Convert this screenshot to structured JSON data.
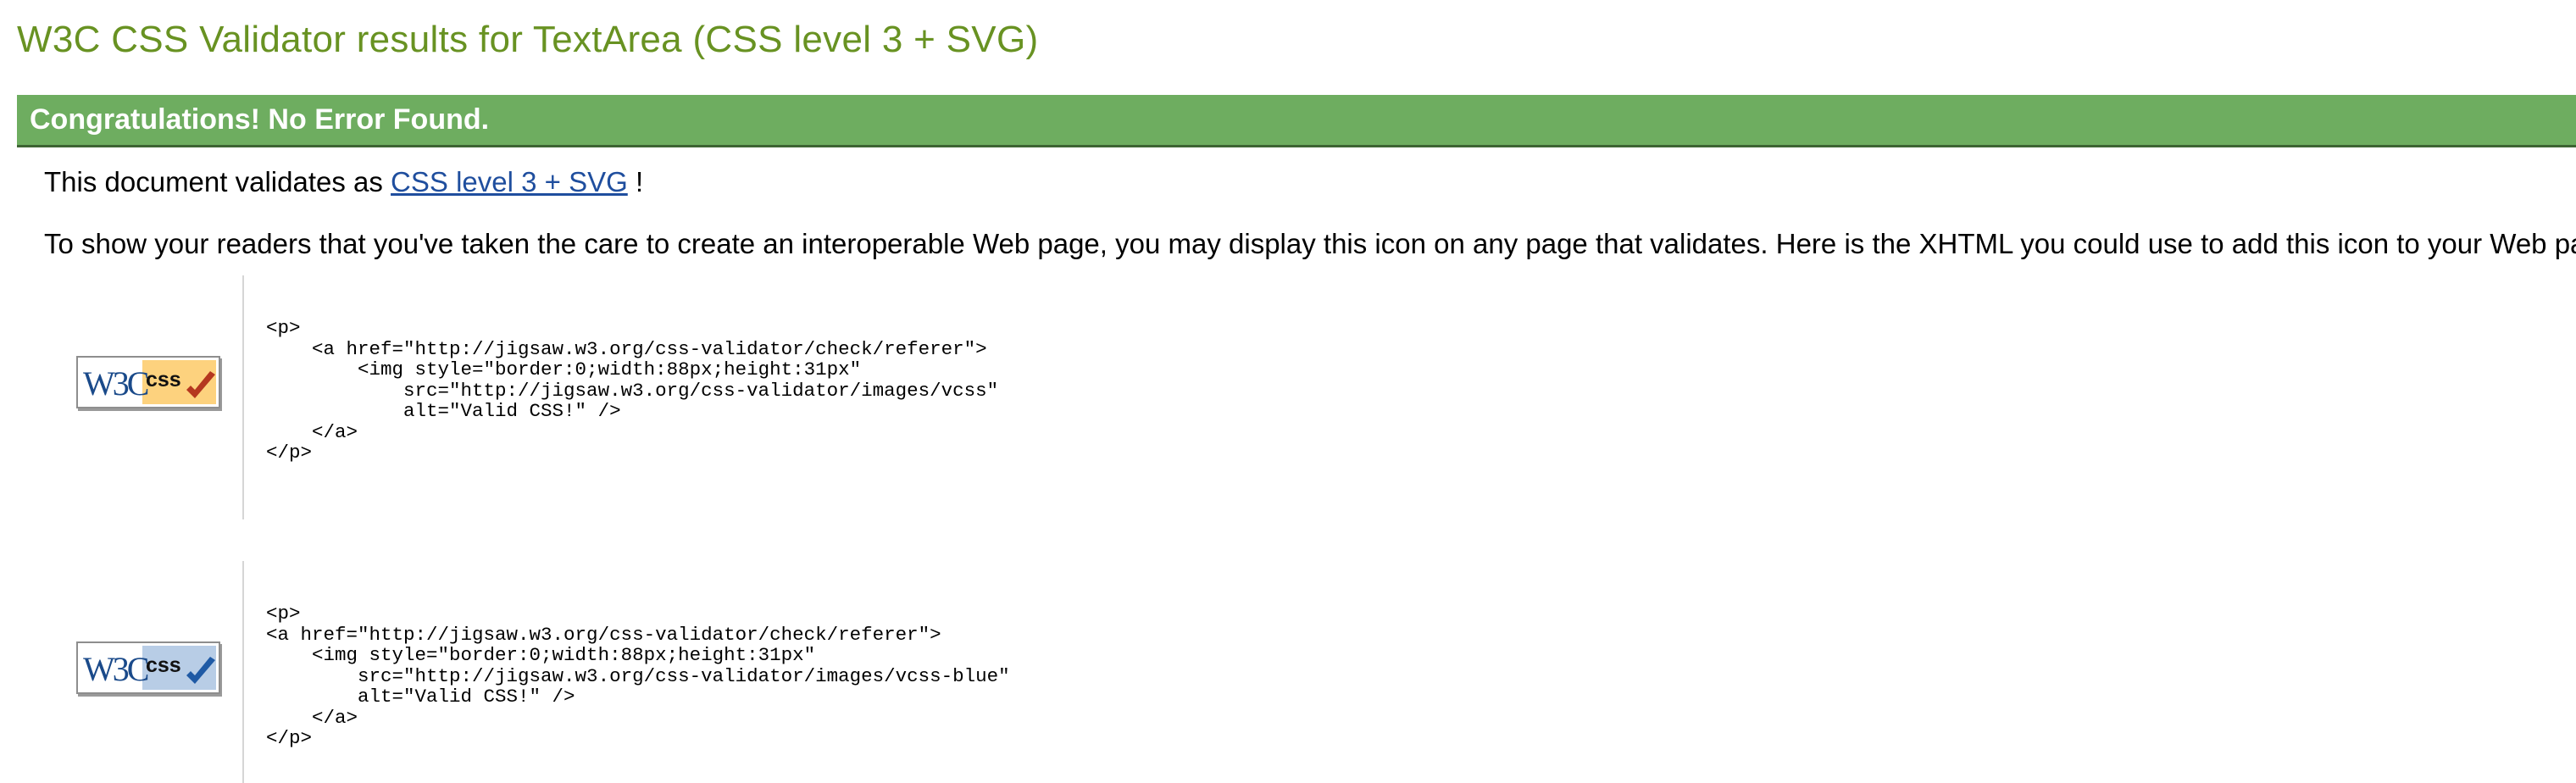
{
  "header": {
    "title": "W3C CSS Validator results for TextArea (CSS level 3 + SVG)"
  },
  "result": {
    "message": "Congratulations! No Error Found."
  },
  "validates": {
    "prefix": "This document validates as",
    "link_text": "CSS level 3 + SVG",
    "suffix": "!"
  },
  "instructions": {
    "text": "To show your readers that you've taken the care to create an interoperable Web page, you may display this icon on any page that validates. Here is the XHTML you could use to add this icon to your Web page:"
  },
  "badges": [
    {
      "logo_text": "W3C",
      "css_text": "css",
      "variant": "gold",
      "panel_color": "#fdd27e",
      "check_color": "#b5371f",
      "code": "<p>\n    <a href=\"http://jigsaw.w3.org/css-validator/check/referer\">\n        <img style=\"border:0;width:88px;height:31px\"\n            src=\"http://jigsaw.w3.org/css-validator/images/vcss\"\n            alt=\"Valid CSS!\" />\n    </a>\n</p>"
    },
    {
      "logo_text": "W3C",
      "css_text": "css",
      "variant": "blue",
      "panel_color": "#b8cde6",
      "check_color": "#1f5aa5",
      "code": "<p>\n<a href=\"http://jigsaw.w3.org/css-validator/check/referer\">\n    <img style=\"border:0;width:88px;height:31px\"\n        src=\"http://jigsaw.w3.org/css-validator/images/vcss-blue\"\n        alt=\"Valid CSS!\" />\n    </a>\n</p>"
    }
  ]
}
